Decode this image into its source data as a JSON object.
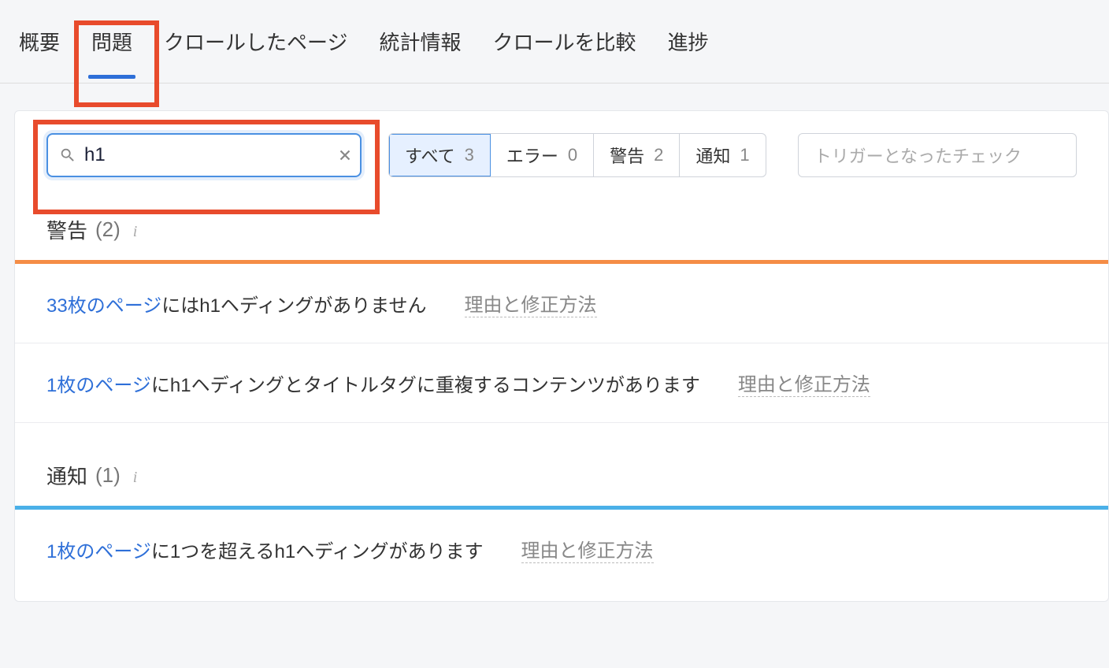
{
  "nav": {
    "overview": "概要",
    "issues": "問題",
    "crawled": "クロールしたページ",
    "stats": "統計情報",
    "compare": "クロールを比較",
    "progress": "進捗"
  },
  "search": {
    "value": "h1"
  },
  "filters": {
    "all_label": "すべて",
    "all_count": "3",
    "error_label": "エラー",
    "error_count": "0",
    "warning_label": "警告",
    "warning_count": "2",
    "notice_label": "通知",
    "notice_count": "1"
  },
  "trigger_placeholder": "トリガーとなったチェック",
  "sections": {
    "warning": {
      "title": "警告",
      "count": "(2)"
    },
    "notice": {
      "title": "通知",
      "count": "(1)"
    }
  },
  "issues": {
    "w1_link": "33枚のページ",
    "w1_text": "にはh1ヘディングがありません",
    "w2_link": "1枚のページ",
    "w2_text": "にh1ヘディングとタイトルタグに重複するコンテンツがあります",
    "n1_link": "1枚のページ",
    "n1_text": "に1つを超えるh1ヘディングがあります"
  },
  "reason_label": "理由と修正方法"
}
